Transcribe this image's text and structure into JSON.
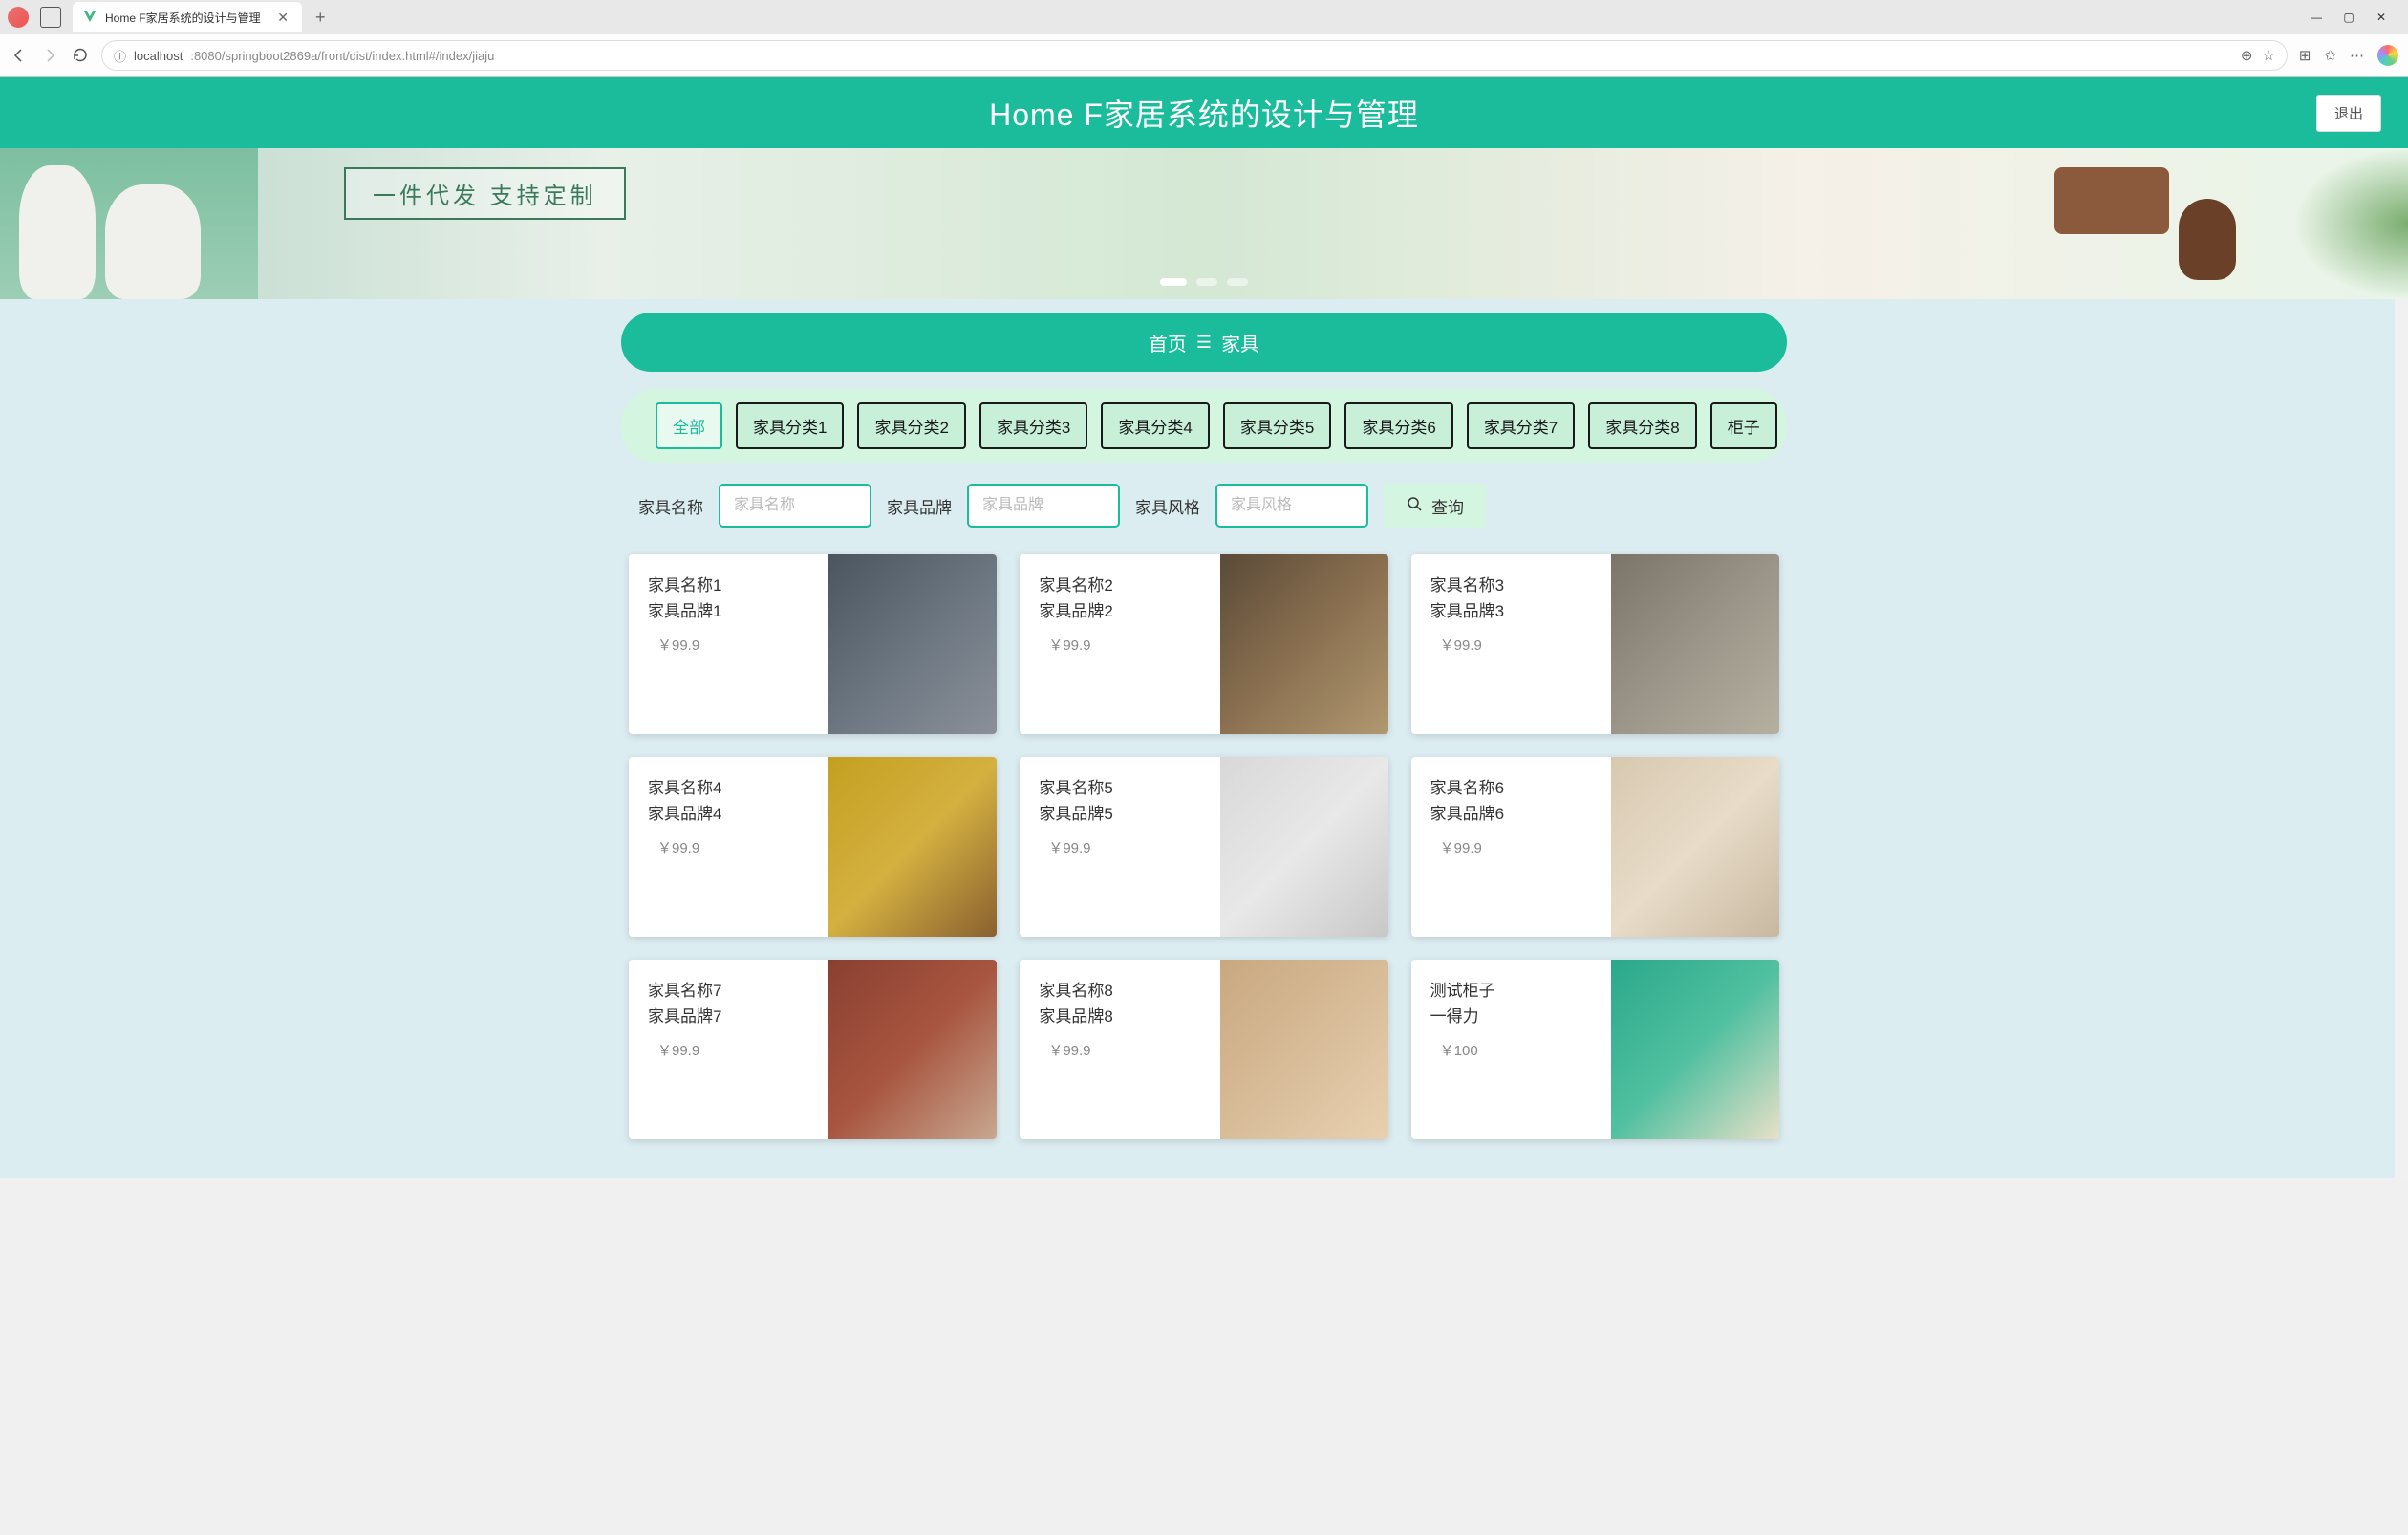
{
  "browser": {
    "tab_title": "Home F家居系统的设计与管理",
    "url_host": "localhost",
    "url_path": ":8080/springboot2869a/front/dist/index.html#/index/jiaju"
  },
  "header": {
    "title": "Home F家居系统的设计与管理",
    "logout": "退出"
  },
  "banner": {
    "text": "一件代发  支持定制"
  },
  "nav": {
    "home": "首页",
    "separator": "☰",
    "current": "家具"
  },
  "categories": [
    "全部",
    "家具分类1",
    "家具分类2",
    "家具分类3",
    "家具分类4",
    "家具分类5",
    "家具分类6",
    "家具分类7",
    "家具分类8",
    "柜子"
  ],
  "search": {
    "name_label": "家具名称",
    "name_placeholder": "家具名称",
    "brand_label": "家具品牌",
    "brand_placeholder": "家具品牌",
    "style_label": "家具风格",
    "style_placeholder": "家具风格",
    "button": "查询"
  },
  "products": [
    {
      "name": "家具名称1",
      "brand": "家具品牌1",
      "price": "￥99.9"
    },
    {
      "name": "家具名称2",
      "brand": "家具品牌2",
      "price": "￥99.9"
    },
    {
      "name": "家具名称3",
      "brand": "家具品牌3",
      "price": "￥99.9"
    },
    {
      "name": "家具名称4",
      "brand": "家具品牌4",
      "price": "￥99.9"
    },
    {
      "name": "家具名称5",
      "brand": "家具品牌5",
      "price": "￥99.9"
    },
    {
      "name": "家具名称6",
      "brand": "家具品牌6",
      "price": "￥99.9"
    },
    {
      "name": "家具名称7",
      "brand": "家具品牌7",
      "price": "￥99.9"
    },
    {
      "name": "家具名称8",
      "brand": "家具品牌8",
      "price": "￥99.9"
    },
    {
      "name": "测试柜子",
      "brand": "一得力",
      "price": "￥100"
    }
  ]
}
